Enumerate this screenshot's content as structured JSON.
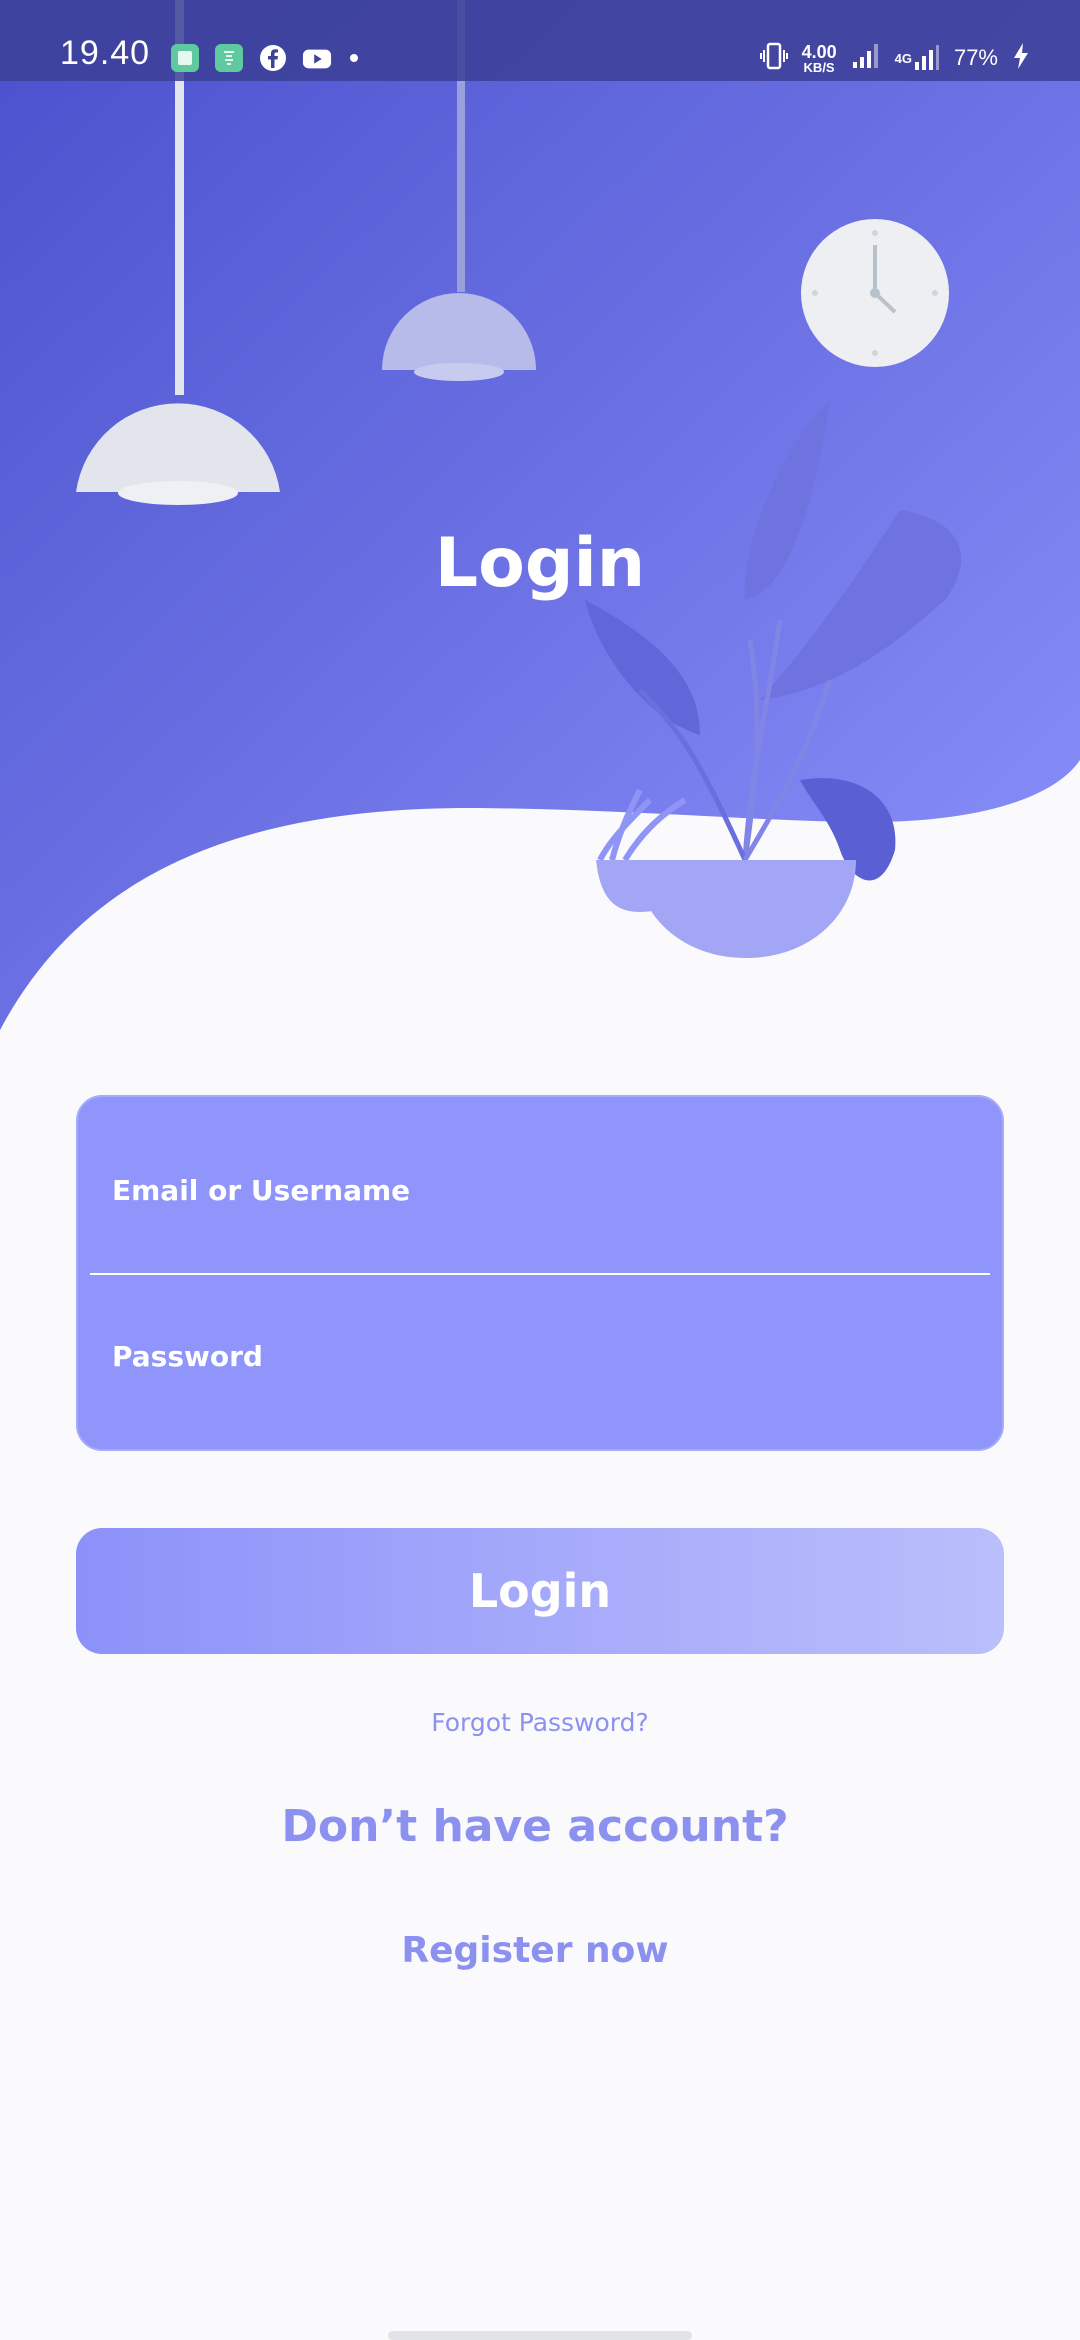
{
  "status_bar": {
    "time": "19.40",
    "net_speed_value": "4.00",
    "net_speed_unit": "KB/S",
    "network_type": "4G",
    "battery": "77%"
  },
  "header": {
    "title": "Login"
  },
  "form": {
    "email_placeholder": "Email or Username",
    "password_placeholder": "Password",
    "login_label": "Login",
    "forgot_label": "Forgot Password?"
  },
  "register": {
    "prompt": "Don’t have account?",
    "link_label": "Register now"
  },
  "colors": {
    "gradient_start": "#4a50cc",
    "gradient_end": "#8c92fb",
    "card": "#8f95fa",
    "accent_text": "#8c91f0",
    "background": "#fafafd"
  },
  "icons": {
    "notifications": [
      "app-notification-icon",
      "shield-app-icon",
      "facebook-icon",
      "youtube-icon",
      "more-dot-icon"
    ],
    "system": [
      "vibrate-icon",
      "signal-icon",
      "signal-4g-icon",
      "charging-icon"
    ]
  }
}
